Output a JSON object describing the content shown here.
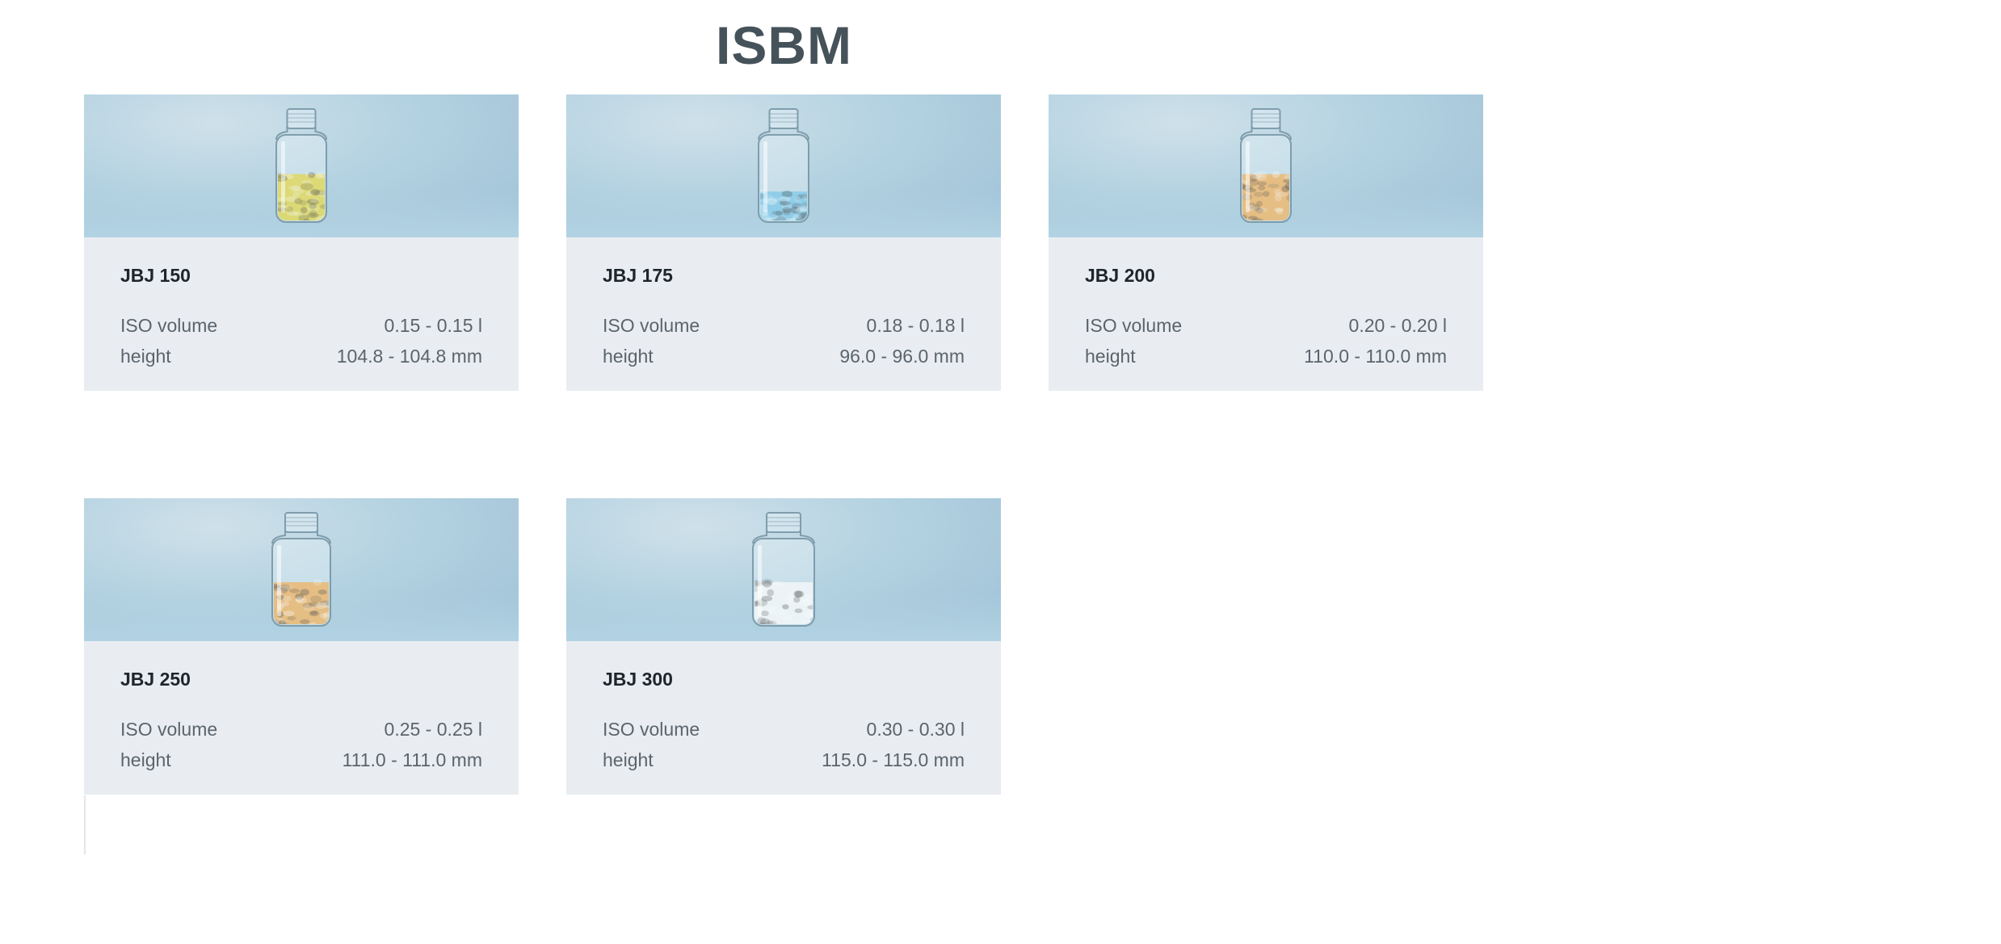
{
  "page": {
    "title": "ISBM"
  },
  "colors": {
    "title": "#45525a",
    "card_background": "#e9edf2",
    "image_background": "#b4d2e1",
    "name_text": "#1e252b",
    "spec_text": "#5b646c"
  },
  "products": [
    {
      "name": "JBJ 150",
      "icon": "pill-bottle-yellow-softgels-icon",
      "fill_color": "#d7c81e",
      "fill_level": 0.55,
      "specs": [
        {
          "label": "ISO volume",
          "value": "0.15 - 0.15 l"
        },
        {
          "label": "height",
          "value": "104.8 - 104.8 mm"
        }
      ]
    },
    {
      "name": "JBJ 175",
      "icon": "pill-bottle-blue-tablets-icon",
      "fill_color": "#56b4e0",
      "fill_level": 0.35,
      "specs": [
        {
          "label": "ISO volume",
          "value": "0.18 - 0.18 l"
        },
        {
          "label": "height",
          "value": "96.0 - 96.0 mm"
        }
      ]
    },
    {
      "name": "JBJ 200",
      "icon": "pill-bottle-orange-capsules-icon",
      "fill_color": "#e89a35",
      "fill_level": 0.55,
      "specs": [
        {
          "label": "ISO volume",
          "value": "0.20 - 0.20 l"
        },
        {
          "label": "height",
          "value": "110.0 - 110.0 mm"
        }
      ]
    },
    {
      "name": "JBJ 250",
      "icon": "pill-bottle-orange-capsules-icon",
      "fill_color": "#e89a35",
      "fill_level": 0.5,
      "specs": [
        {
          "label": "ISO volume",
          "value": "0.25 - 0.25 l"
        },
        {
          "label": "height",
          "value": "111.0 - 111.0 mm"
        }
      ]
    },
    {
      "name": "JBJ 300",
      "icon": "pill-bottle-white-tablets-icon",
      "fill_color": "#f2f4f6",
      "fill_level": 0.5,
      "specs": [
        {
          "label": "ISO volume",
          "value": "0.30 - 0.30 l"
        },
        {
          "label": "height",
          "value": "115.0 - 115.0 mm"
        }
      ]
    }
  ]
}
